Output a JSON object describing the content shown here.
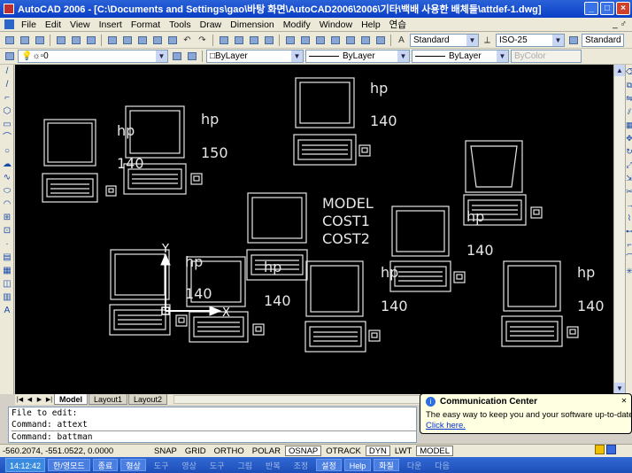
{
  "window": {
    "title": "AutoCAD 2006 - [C:\\Documents and Settings\\gao\\바탕 화면\\AutoCAD2006\\2006\\기타\\백배 사용한 배체들\\attdef-1.dwg]",
    "minimize_label": "_",
    "maximize_label": "□",
    "close_label": "×"
  },
  "menu": {
    "items": [
      "File",
      "Edit",
      "View",
      "Insert",
      "Format",
      "Tools",
      "Draw",
      "Dimension",
      "Modify",
      "Window",
      "Help",
      "연습"
    ],
    "doc_controls": "_ ♂"
  },
  "toolbar": {
    "text_style": "Standard",
    "dim_style": "ISO-25",
    "table_style": "Standard"
  },
  "layers": {
    "current_layer": "0",
    "color": "ByLayer",
    "linetype": "ByLayer",
    "lineweight": "ByLayer",
    "plot_style": "ByColor"
  },
  "drawing": {
    "texts": {
      "hp_label": "hp",
      "num_140": "140",
      "num_150": "150",
      "model": "MODEL",
      "cost1": "COST1",
      "cost2": "COST2",
      "ucs_x": "X",
      "ucs_y": "Y"
    }
  },
  "tabs": {
    "items": [
      "Model",
      "Layout1",
      "Layout2"
    ],
    "active": "Model"
  },
  "command": {
    "history": [
      "File to edit:",
      "Command: attext"
    ],
    "prompt": "Command: battman"
  },
  "status": {
    "coordinates": "-560.2074, -551.0522, 0.0000",
    "buttons": [
      "SNAP",
      "GRID",
      "ORTHO",
      "POLAR",
      "OSNAP",
      "OTRACK",
      "DYN",
      "LWT",
      "MODEL"
    ],
    "active_buttons": [
      "OSNAP",
      "DYN",
      "MODEL"
    ]
  },
  "notification": {
    "title": "Communication Center",
    "body": "The easy way to keep you and your software up-to-date,",
    "link": "Click here."
  },
  "taskbar": {
    "clock": "14:12:42",
    "items": [
      "한/영모드",
      "종료",
      "형상",
      "도구",
      "영상",
      "도구",
      "그림",
      "반복",
      "조정",
      "설정",
      "Help",
      "화질",
      "다운",
      "다음"
    ]
  },
  "colors": {
    "canvas": "#000000",
    "entity": "#e6e6e6",
    "title_bar": "#0b3fc7"
  }
}
